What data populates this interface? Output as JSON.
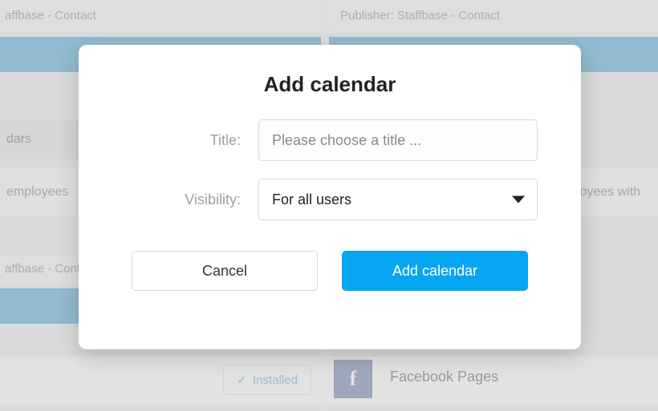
{
  "background": {
    "publisher_left": "affbase - Contact",
    "publisher_right": "Publisher: Staffbase - Contact",
    "mid_heading_left": "dars",
    "mid_body_left": " employees",
    "mid_body_right": "ployees with",
    "publisher2_left": "affbase - Conta",
    "installed_label": "Installed",
    "fb_label": "Facebook Pages",
    "fb_glyph": "f"
  },
  "modal": {
    "title": "Add calendar",
    "fields": {
      "title_label": "Title:",
      "title_placeholder": "Please choose a title ...",
      "title_value": "",
      "visibility_label": "Visibility:",
      "visibility_value": "For all users"
    },
    "buttons": {
      "cancel": "Cancel",
      "submit": "Add calendar"
    }
  }
}
